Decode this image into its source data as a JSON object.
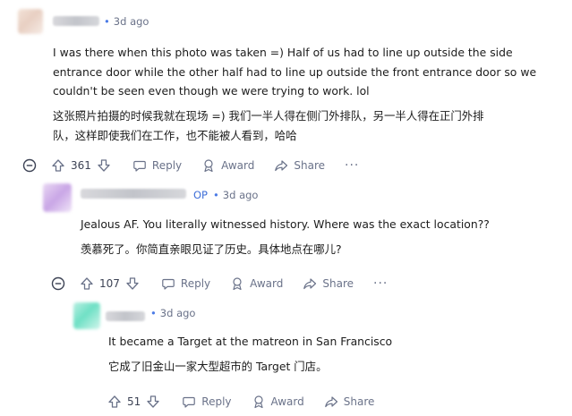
{
  "comments": [
    {
      "time": "3d ago",
      "dot": "•",
      "text_en": "I was there when this photo was taken =) Half of us had to line up outside the side",
      "text_en_2": "entrance door while the other half had to line up outside the front entrance door so we",
      "text_en_3": "couldn't be seen even though we were trying to work. lol",
      "text_zh": "这张照片拍摄的时候我就在现场 =) 我们一半人得在侧门外排队，另一半人得在正门外排",
      "text_zh_2": "队，这样即使我们在工作，也不能被人看到，哈哈",
      "votes": "361",
      "reply_label": "Reply",
      "award_label": "Award",
      "share_label": "Share",
      "more_label": "···"
    },
    {
      "op_label": "OP",
      "time": "3d ago",
      "dot": "•",
      "text_en": "Jealous AF. You literally witnessed history. Where was the exact location??",
      "text_zh": "羡慕死了。你简直亲眼见证了历史。具体地点在哪儿?",
      "votes": "107",
      "reply_label": "Reply",
      "award_label": "Award",
      "share_label": "Share",
      "more_label": "···"
    },
    {
      "time": "3d ago",
      "dot": "•",
      "text_en": "It became a Target at the matreon in San Francisco",
      "text_zh": "它成了旧金山一家大型超市的 Target 门店。",
      "votes": "51",
      "reply_label": "Reply",
      "award_label": "Award",
      "share_label": "Share"
    }
  ],
  "colors": {
    "meta": "#6a7289",
    "op": "#3f6fd8",
    "text": "#1c1c1c"
  },
  "icons": [
    "collapse-icon",
    "upvote-icon",
    "downvote-icon",
    "reply-icon",
    "award-icon",
    "share-icon",
    "more-icon"
  ]
}
